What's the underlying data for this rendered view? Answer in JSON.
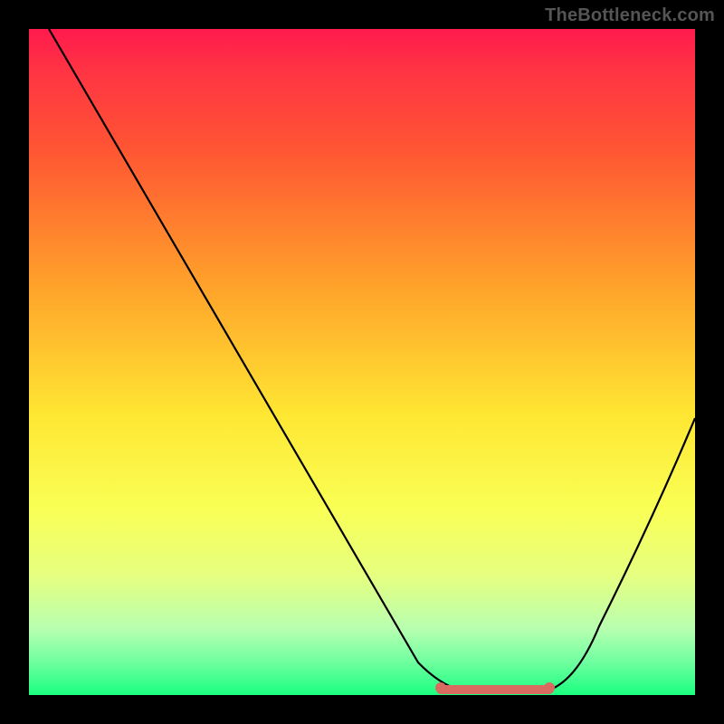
{
  "watermark": "TheBottleneck.com",
  "chart_data": {
    "type": "line",
    "title": "",
    "xlabel": "",
    "ylabel": "",
    "xlim": [
      0,
      100
    ],
    "ylim": [
      0,
      100
    ],
    "grid": false,
    "legend": false,
    "series": [
      {
        "name": "bottleneck-curve",
        "x": [
          3,
          10,
          20,
          30,
          40,
          50,
          58,
          63,
          68,
          73,
          78,
          85,
          92,
          100
        ],
        "y": [
          100,
          88,
          73,
          58,
          43,
          28,
          14,
          6,
          1,
          0,
          1,
          10,
          24,
          42
        ]
      }
    ],
    "optimal_segment": {
      "x_start": 63,
      "x_end": 78,
      "y": 0.5
    },
    "background_gradient_top": "#ff1a4d",
    "background_gradient_bottom": "#1aff80"
  }
}
